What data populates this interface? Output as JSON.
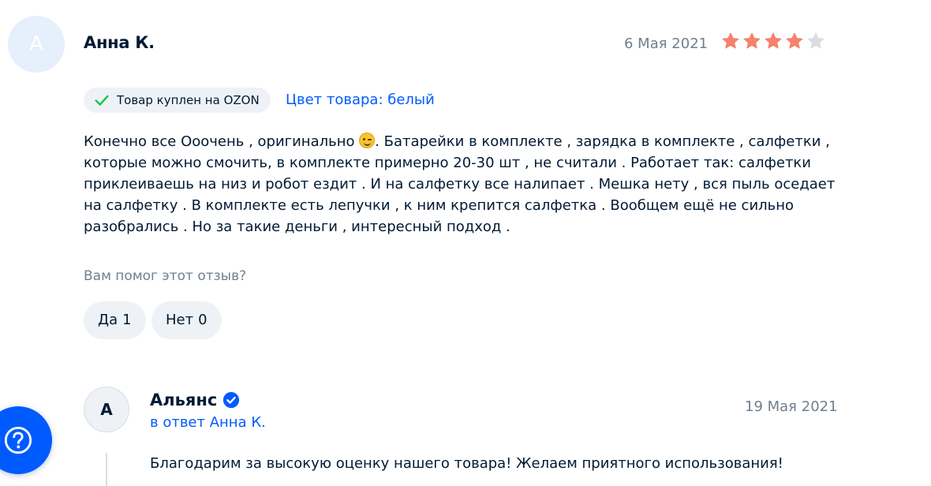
{
  "review": {
    "avatar_letter": "А",
    "author": "Анна К.",
    "date": "6 Мая 2021",
    "rating": 4,
    "rating_max": 5,
    "purchase_badge": "Товар куплен на OZON",
    "product_color": "Цвет товара: белый",
    "text_before_emoji": "Конечно все Ооочень , оригинально ",
    "emoji": "winking-face-emoji",
    "text_after_emoji": ". Батарейки в комплекте , зарядка в комплекте , салфетки , которые можно смочить, в комплекте примерно 20-30 шт , не считали . Работает так: салфетки приклеиваешь на низ и робот ездит . И на салфетку все налипает . Мешка нету , вся пыль оседает на салфетку . В комплекте есть лепучки , к ним крепится салфетка . Вообщем ещё не сильно разобрались . Но за такие деньги , интересный подход .",
    "helpful_question": "Вам помог этот отзыв?",
    "yes_label": "Да",
    "yes_count": "1",
    "no_label": "Нет",
    "no_count": "0"
  },
  "reply": {
    "avatar_letter": "А",
    "author": "Альянс",
    "reply_to": "в ответ Анна К.",
    "date": "19 Мая 2021",
    "text": "Благодарим за высокую оценку нашего товара! Желаем приятного использования!"
  },
  "help_button": {
    "icon": "question-circle-icon"
  },
  "colors": {
    "accent": "#005bff",
    "star_filled": "#f5826b",
    "star_empty": "#dadee3",
    "check": "#10c44c",
    "text": "#001a34",
    "muted": "#707f8d",
    "chip_bg": "#eef2f6"
  }
}
